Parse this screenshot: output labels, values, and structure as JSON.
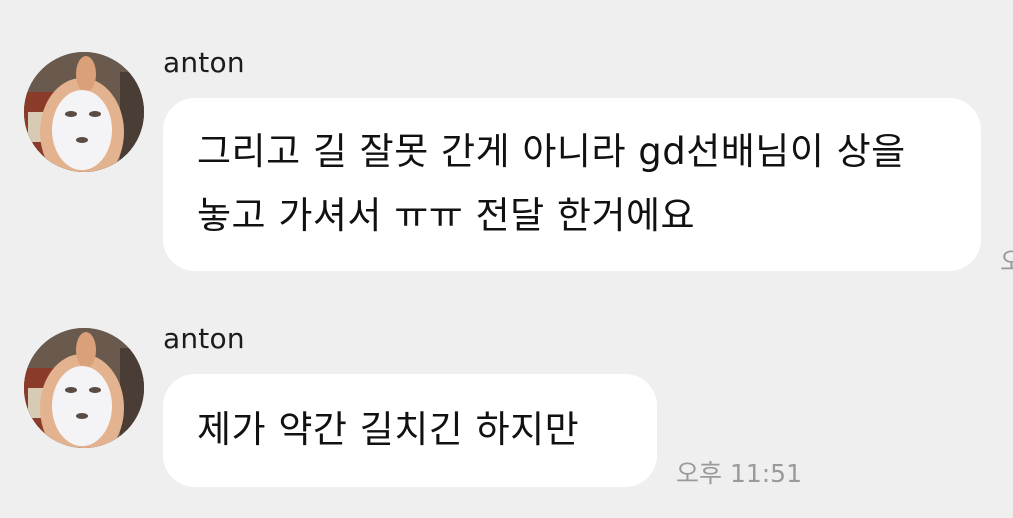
{
  "colors": {
    "background": "#efefef",
    "bubble": "#ffffff",
    "text": "#111111",
    "timestamp": "#9a9a9a"
  },
  "messages": [
    {
      "sender": "anton",
      "avatar_icon": "face-mask-avatar-icon",
      "text": "그리고 길 잘못 간게 아니라 gd선배님이 상을 놓고 가셔서 ㅠㅠ 전달 한거에요",
      "time": "오"
    },
    {
      "sender": "anton",
      "avatar_icon": "face-mask-avatar-icon",
      "text": "제가 약간 길치긴 하지만",
      "time": "오후 11:51"
    }
  ]
}
